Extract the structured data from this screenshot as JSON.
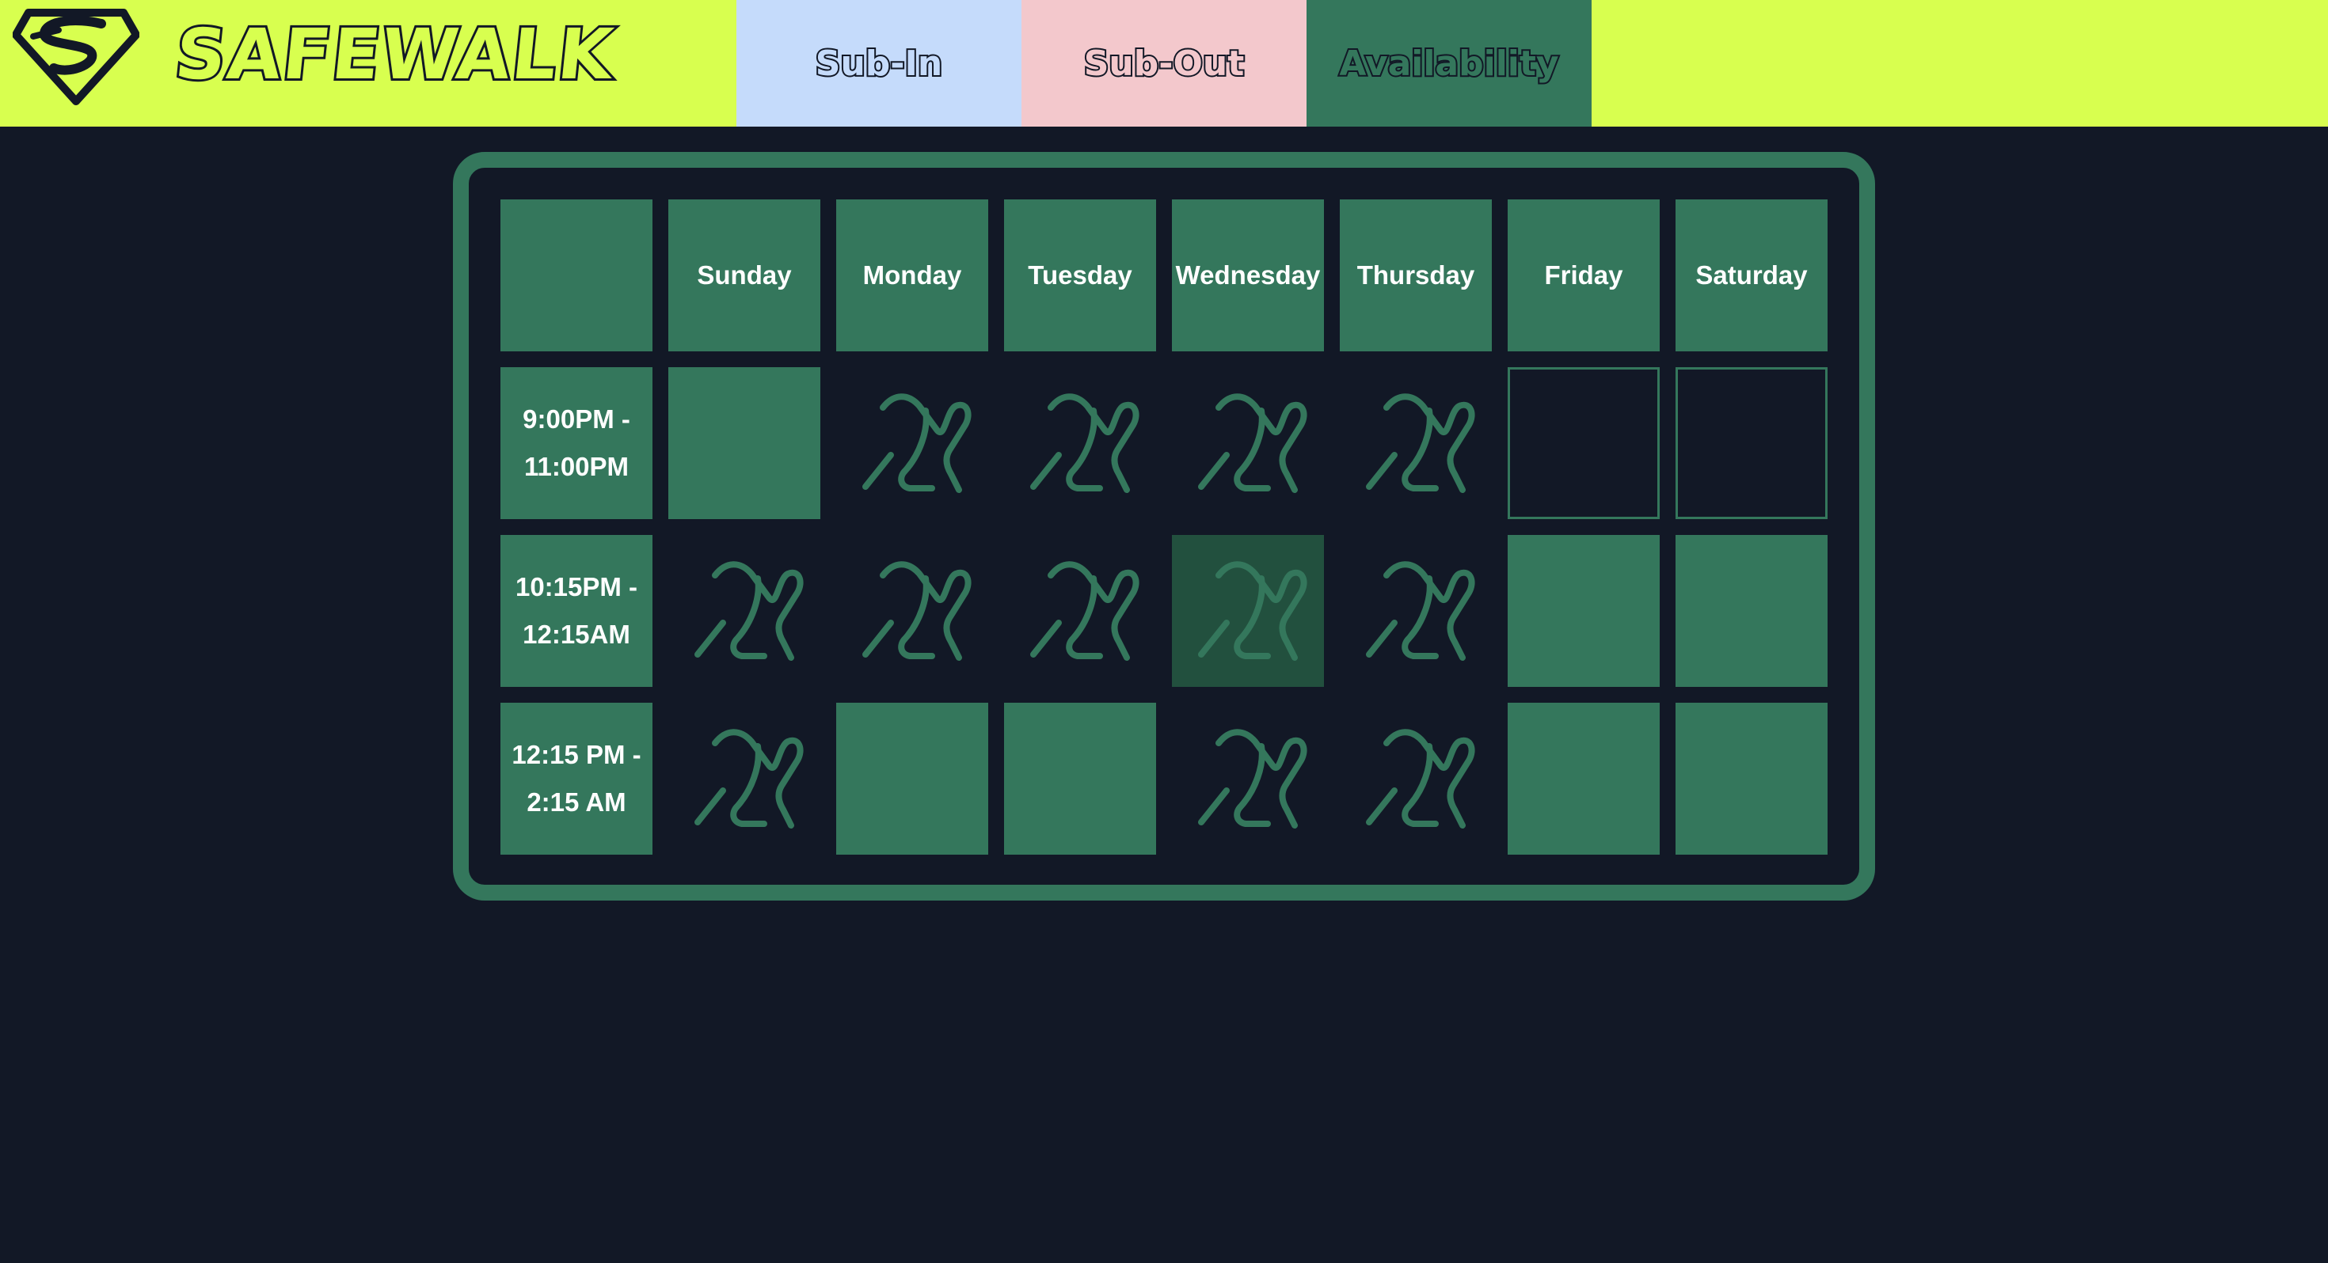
{
  "brand": {
    "name": "SAFEWALK",
    "icon": "superman-shield-icon"
  },
  "nav": {
    "tabs": [
      {
        "label": "Sub-In",
        "color": "#c5dbfb"
      },
      {
        "label": "Sub-Out",
        "color": "#f3c8cc"
      },
      {
        "label": "Availability",
        "color": "#34775c",
        "active": true
      }
    ]
  },
  "colors": {
    "header": "#d8ff4f",
    "background": "#121826",
    "accent": "#34775c",
    "hover": "#22503e"
  },
  "schedule": {
    "days": [
      "Sunday",
      "Monday",
      "Tuesday",
      "Wednesday",
      "Thursday",
      "Friday",
      "Saturday"
    ],
    "timeslots": [
      "9:00PM -\n11:00PM",
      "10:15PM -\n12:15AM",
      "12:15 PM -\n2:15 AM"
    ],
    "legend": {
      "available": "filled green",
      "unavailable": "x-mark-icon",
      "open": "outlined"
    },
    "grid": [
      [
        "available",
        "unavailable",
        "unavailable",
        "unavailable",
        "unavailable",
        "outlined",
        "outlined"
      ],
      [
        "unavailable",
        "unavailable",
        "unavailable",
        "unavailable-hover",
        "unavailable",
        "available",
        "available"
      ],
      [
        "unavailable",
        "available",
        "available",
        "unavailable",
        "unavailable",
        "available",
        "available"
      ]
    ]
  }
}
